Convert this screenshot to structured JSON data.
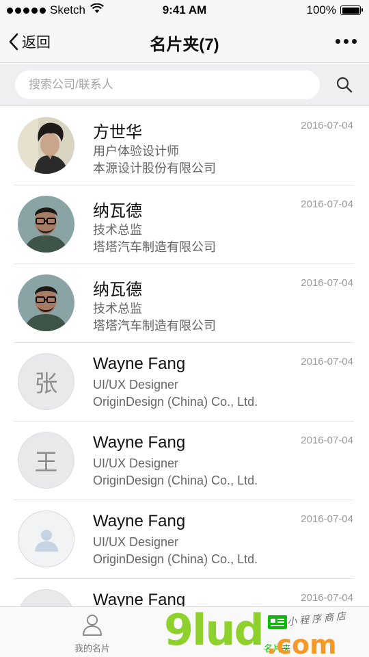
{
  "status_bar": {
    "carrier": "Sketch",
    "time": "9:41 AM",
    "battery": "100%"
  },
  "nav": {
    "back_label": "返回",
    "title": "名片夹(7)"
  },
  "search": {
    "placeholder": "搜索公司/联系人",
    "value": ""
  },
  "contacts": [
    {
      "name": "方世华",
      "title": "用户体验设计师",
      "company": "本源设计股份有限公司",
      "date": "2016-07-04",
      "avatar": "photo"
    },
    {
      "name": "纳瓦德",
      "title": "技术总监",
      "company": "塔塔汽车制造有限公司",
      "date": "2016-07-04",
      "avatar": "photo"
    },
    {
      "name": "纳瓦德",
      "title": "技术总监",
      "company": "塔塔汽车制造有限公司",
      "date": "2016-07-04",
      "avatar": "photo"
    },
    {
      "name": "Wayne Fang",
      "title": "UI/UX Designer",
      "company": "OriginDesign (China) Co., Ltd.",
      "date": "2016-07-04",
      "avatar_text": "张"
    },
    {
      "name": "Wayne Fang",
      "title": "UI/UX Designer",
      "company": "OriginDesign (China) Co., Ltd.",
      "date": "2016-07-04",
      "avatar_text": "王"
    },
    {
      "name": "Wayne Fang",
      "title": "UI/UX Designer",
      "company": "OriginDesign (China) Co., Ltd.",
      "date": "2016-07-04",
      "avatar": "default-user-icon"
    },
    {
      "name": "Wayne Fang",
      "title": "",
      "company": "",
      "date": "2016-07-04",
      "avatar": "default"
    }
  ],
  "tab_bar": {
    "mine_label": "我的名片",
    "cards_label": "名片夹",
    "active_color": "#09bb07"
  },
  "watermark": {
    "logo": "9lud",
    "suffix": ".com",
    "slogan": "小程序商店"
  }
}
